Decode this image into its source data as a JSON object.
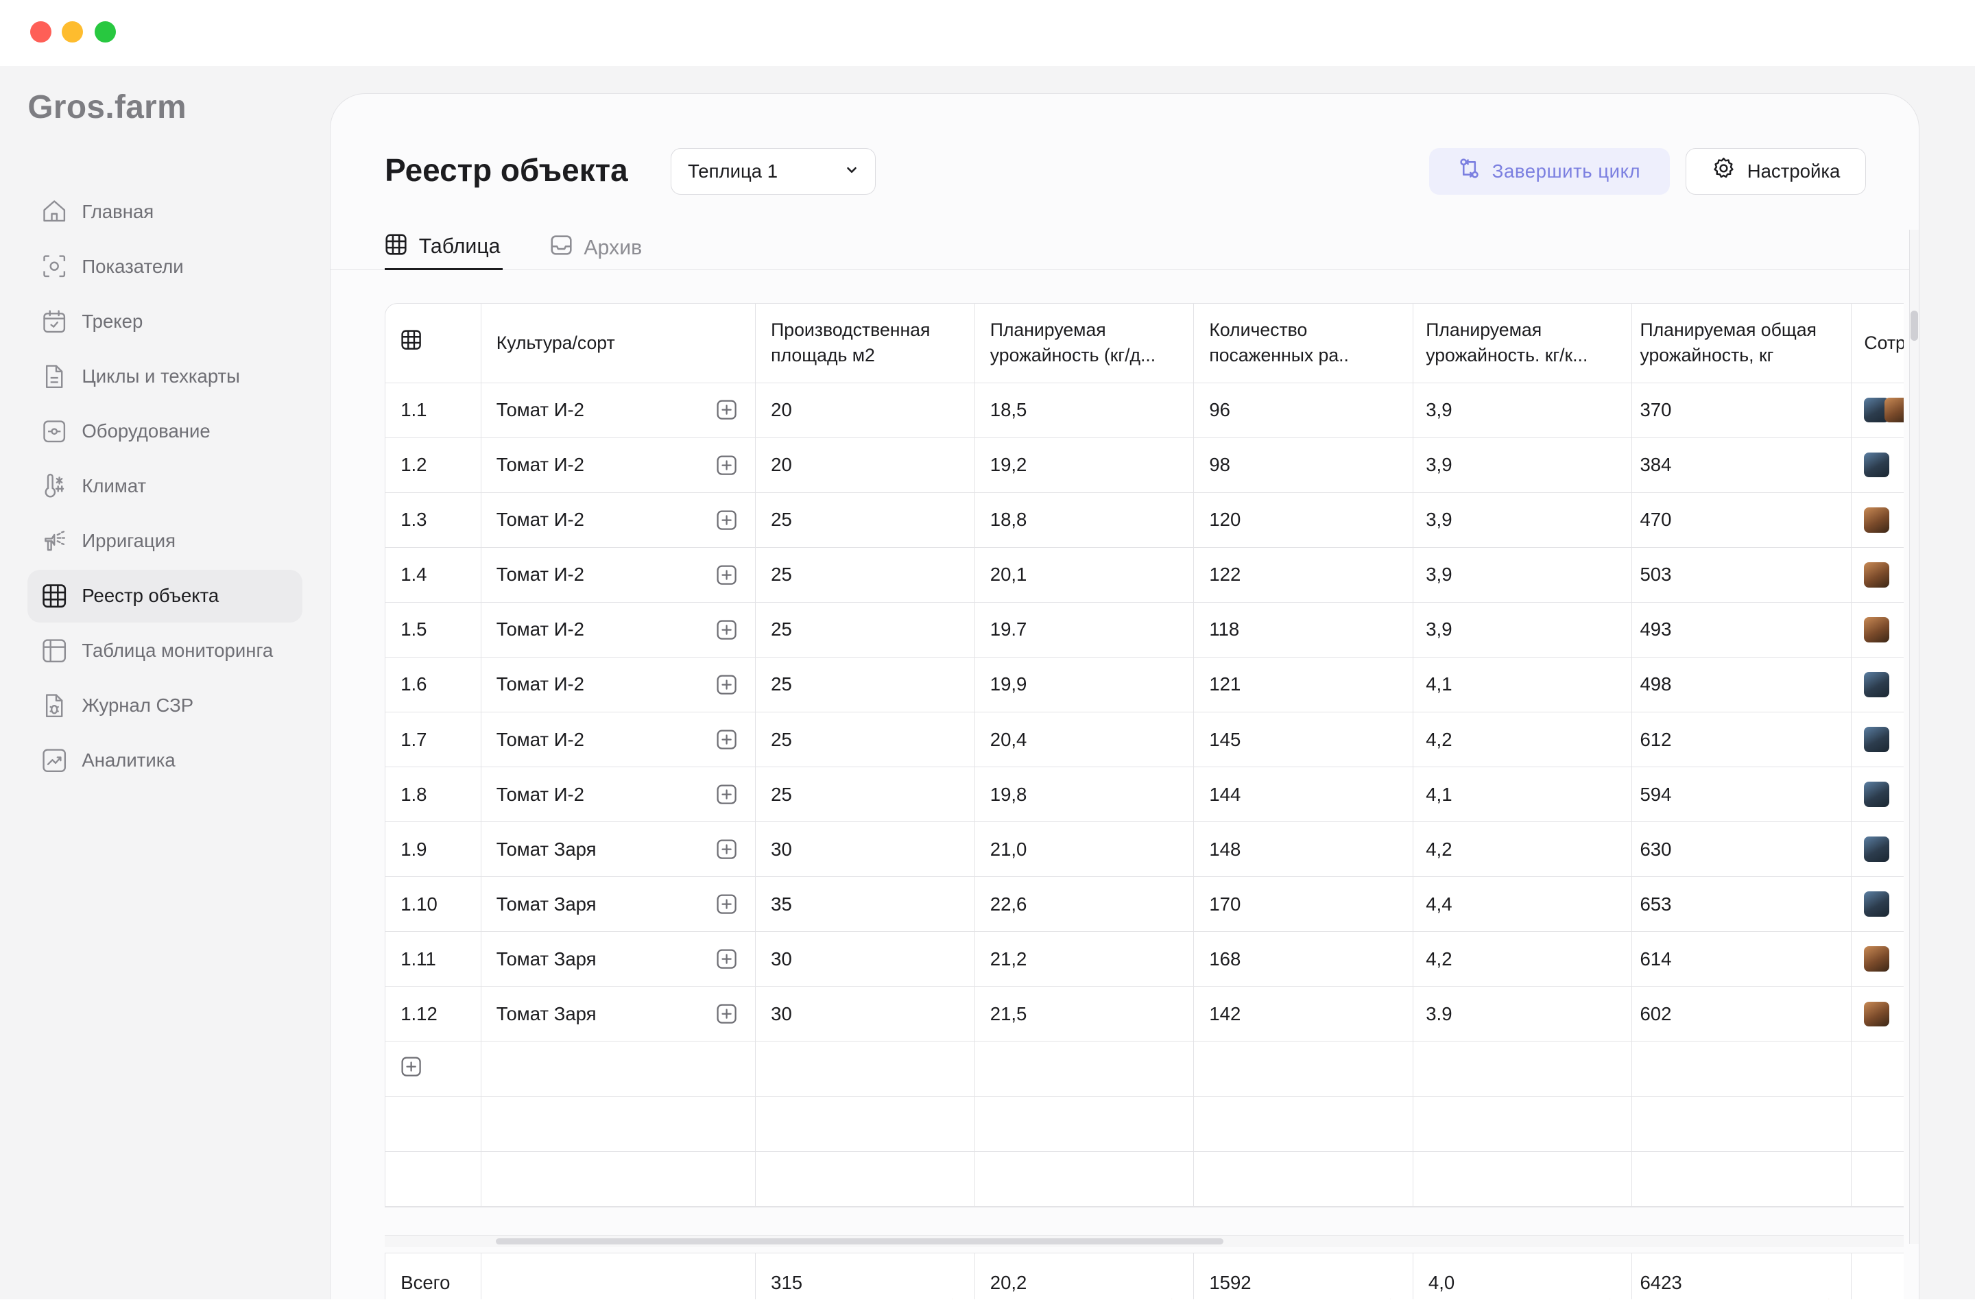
{
  "app": {
    "logo": "Gros.farm"
  },
  "nav": [
    {
      "label": "Главная",
      "icon": "home-icon"
    },
    {
      "label": "Показатели",
      "icon": "indicators-icon"
    },
    {
      "label": "Трекер",
      "icon": "calendar-icon"
    },
    {
      "label": "Циклы и техкарты",
      "icon": "document-icon"
    },
    {
      "label": "Оборудование",
      "icon": "equipment-icon"
    },
    {
      "label": "Климат",
      "icon": "thermometer-icon"
    },
    {
      "label": "Ирригация",
      "icon": "irrigation-icon"
    },
    {
      "label": "Реестр объекта",
      "icon": "grid-icon",
      "active": true
    },
    {
      "label": "Таблица мониторинга",
      "icon": "table-icon"
    },
    {
      "label": "Журнал СЗР",
      "icon": "bug-journal-icon"
    },
    {
      "label": "Аналитика",
      "icon": "chart-icon"
    }
  ],
  "header": {
    "title": "Реестр объекта",
    "select_value": "Теплица 1",
    "finish_label": "Завершить цикл",
    "settings_label": "Настройка"
  },
  "tabs": [
    {
      "label": "Таблица",
      "active": true
    },
    {
      "label": "Архив",
      "active": false
    }
  ],
  "table": {
    "columns": [
      "Культура/сорт",
      "Производственная площадь м2",
      "Планируемая урожайность (кг/д...",
      "Количество посаженных ра..",
      "Планируемая урожайность. кг/к...",
      "Планируемая общая урожайность, кг",
      "Сотр"
    ],
    "rows": [
      {
        "id": "1.1",
        "crop": "Томат И-2",
        "area": "20",
        "yield_plan": "18,5",
        "planted": "96",
        "yield_kg": "3,9",
        "total": "370",
        "staff": [
          "a",
          "b"
        ]
      },
      {
        "id": "1.2",
        "crop": "Томат И-2",
        "area": "20",
        "yield_plan": "19,2",
        "planted": "98",
        "yield_kg": "3,9",
        "total": "384",
        "staff": [
          "a"
        ]
      },
      {
        "id": "1.3",
        "crop": "Томат И-2",
        "area": "25",
        "yield_plan": "18,8",
        "planted": "120",
        "yield_kg": "3,9",
        "total": "470",
        "staff": [
          "b"
        ]
      },
      {
        "id": "1.4",
        "crop": "Томат И-2",
        "area": "25",
        "yield_plan": "20,1",
        "planted": "122",
        "yield_kg": "3,9",
        "total": "503",
        "staff": [
          "b"
        ]
      },
      {
        "id": "1.5",
        "crop": "Томат И-2",
        "area": "25",
        "yield_plan": "19.7",
        "planted": "118",
        "yield_kg": "3,9",
        "total": "493",
        "staff": [
          "b"
        ]
      },
      {
        "id": "1.6",
        "crop": "Томат И-2",
        "area": "25",
        "yield_plan": "19,9",
        "planted": "121",
        "yield_kg": "4,1",
        "total": "498",
        "staff": [
          "a"
        ]
      },
      {
        "id": "1.7",
        "crop": "Томат И-2",
        "area": "25",
        "yield_plan": "20,4",
        "planted": "145",
        "yield_kg": "4,2",
        "total": "612",
        "staff": [
          "a"
        ]
      },
      {
        "id": "1.8",
        "crop": "Томат И-2",
        "area": "25",
        "yield_plan": "19,8",
        "planted": "144",
        "yield_kg": "4,1",
        "total": "594",
        "staff": [
          "a"
        ]
      },
      {
        "id": "1.9",
        "crop": "Томат Заря",
        "area": "30",
        "yield_plan": "21,0",
        "planted": "148",
        "yield_kg": "4,2",
        "total": "630",
        "staff": [
          "a"
        ]
      },
      {
        "id": "1.10",
        "crop": "Томат Заря",
        "area": "35",
        "yield_plan": "22,6",
        "planted": "170",
        "yield_kg": "4,4",
        "total": "653",
        "staff": [
          "a"
        ]
      },
      {
        "id": "1.11",
        "crop": "Томат Заря",
        "area": "30",
        "yield_plan": "21,2",
        "planted": "168",
        "yield_kg": "4,2",
        "total": "614",
        "staff": [
          "b"
        ]
      },
      {
        "id": "1.12",
        "crop": "Томат Заря",
        "area": "30",
        "yield_plan": "21,5",
        "planted": "142",
        "yield_kg": "3.9",
        "total": "602",
        "staff": [
          "b"
        ]
      }
    ],
    "totals": {
      "label": "Всего",
      "area": "315",
      "yield_plan": "20,2",
      "planted": "1592",
      "yield_kg": "4,0",
      "total": "6423"
    }
  }
}
